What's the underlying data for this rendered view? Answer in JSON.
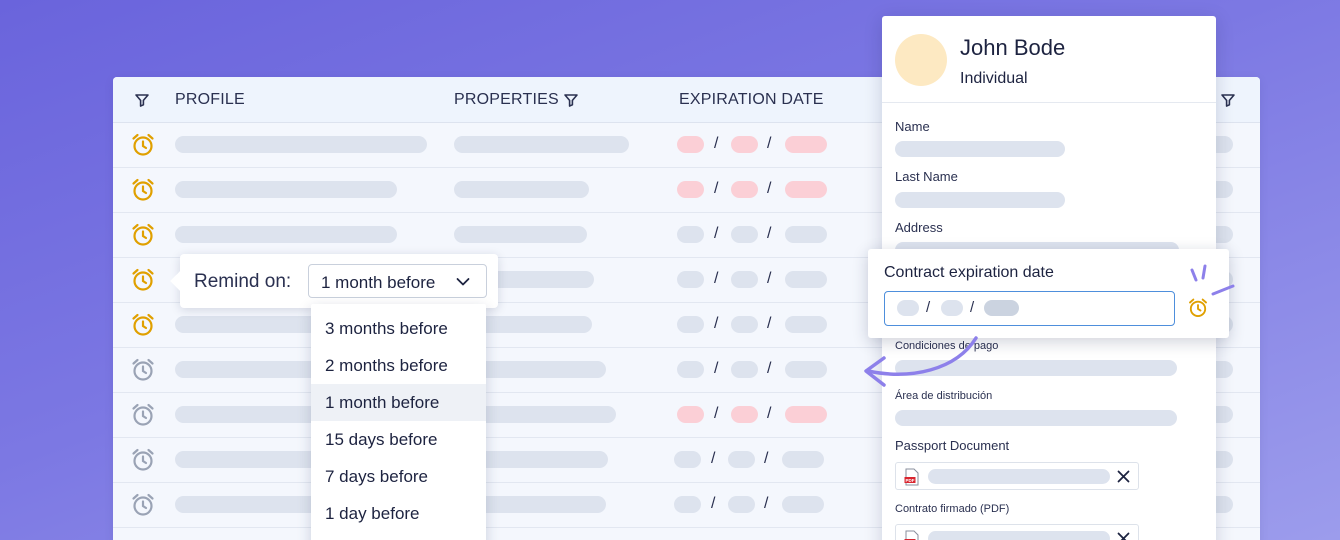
{
  "table": {
    "headers": {
      "profile": "PROFILE",
      "properties": "PROPERTIES",
      "expiration": "EXPIRATION DATE"
    },
    "date_separator": "/",
    "rows": [
      {
        "alarm_active": true,
        "expired": true
      },
      {
        "alarm_active": true,
        "expired": true
      },
      {
        "alarm_active": true,
        "expired": false
      },
      {
        "alarm_active": true,
        "expired": false
      },
      {
        "alarm_active": true,
        "expired": false
      },
      {
        "alarm_active": false,
        "expired": false
      },
      {
        "alarm_active": false,
        "expired": true
      },
      {
        "alarm_active": false,
        "expired": false
      },
      {
        "alarm_active": false,
        "expired": false
      }
    ]
  },
  "reminder": {
    "label": "Remind on:",
    "selected": "1 month before",
    "options": [
      "3 months before",
      "2 months before",
      "1 month before",
      "15 days before",
      "7 days before",
      "1 day before"
    ]
  },
  "profile_panel": {
    "name": "John Bode",
    "type": "Individual",
    "fields": {
      "name": "Name",
      "last_name": "Last Name",
      "address": "Address",
      "payment_terms": "Condiciones de pago",
      "distribution_area": "Área de distribución",
      "passport": "Passport Document",
      "signed_contract": "Contrato firmado (PDF)"
    }
  },
  "contract_popup": {
    "title": "Contract expiration date",
    "separator": "/"
  },
  "colors": {
    "alarm_active": "#e0a000",
    "alarm_inactive": "#9aa3b5",
    "expired_pill": "#fbcfd6",
    "placeholder_pill": "#dde3ee",
    "input_focus": "#4e8fdc",
    "arrow": "#8d80ea"
  }
}
